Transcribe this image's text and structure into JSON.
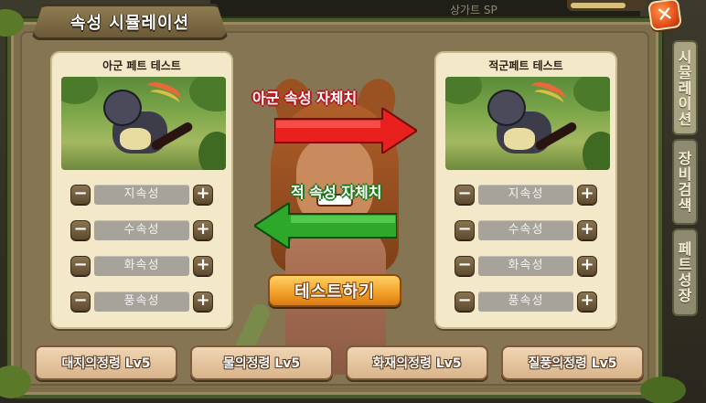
{
  "background": {
    "sp_label": "상가트 SP"
  },
  "dialog": {
    "title": "속성 시뮬레이션",
    "close_icon": "x-icon"
  },
  "side_tabs": [
    {
      "label": [
        "시",
        "뮬",
        "레",
        "이",
        "션"
      ]
    },
    {
      "label": [
        "장",
        "비",
        "검",
        "색"
      ]
    },
    {
      "label": [
        "페",
        "트",
        "성",
        "장"
      ]
    }
  ],
  "left_card": {
    "title": "아군 페트 테스트",
    "attributes": [
      "지속성",
      "수속성",
      "화속성",
      "풍속성"
    ]
  },
  "right_card": {
    "title": "적군페트 테스트",
    "attributes": [
      "지속성",
      "수속성",
      "화속성",
      "풍속성"
    ]
  },
  "arrows": {
    "ally_label": "아군 속성 자체치",
    "enemy_label": "적 속성 자체치",
    "ally_color": "#e8201e",
    "enemy_color": "#2ea82a"
  },
  "test_button": "테스트하기",
  "spirits": [
    "대지의정령 Lv5",
    "물의정령 Lv5",
    "화재의정령 Lv5",
    "질풍의정령 Lv5"
  ],
  "colors": {
    "panel": "#857552",
    "card": "#f3e8c8",
    "button_orange": "#f3a32a"
  }
}
